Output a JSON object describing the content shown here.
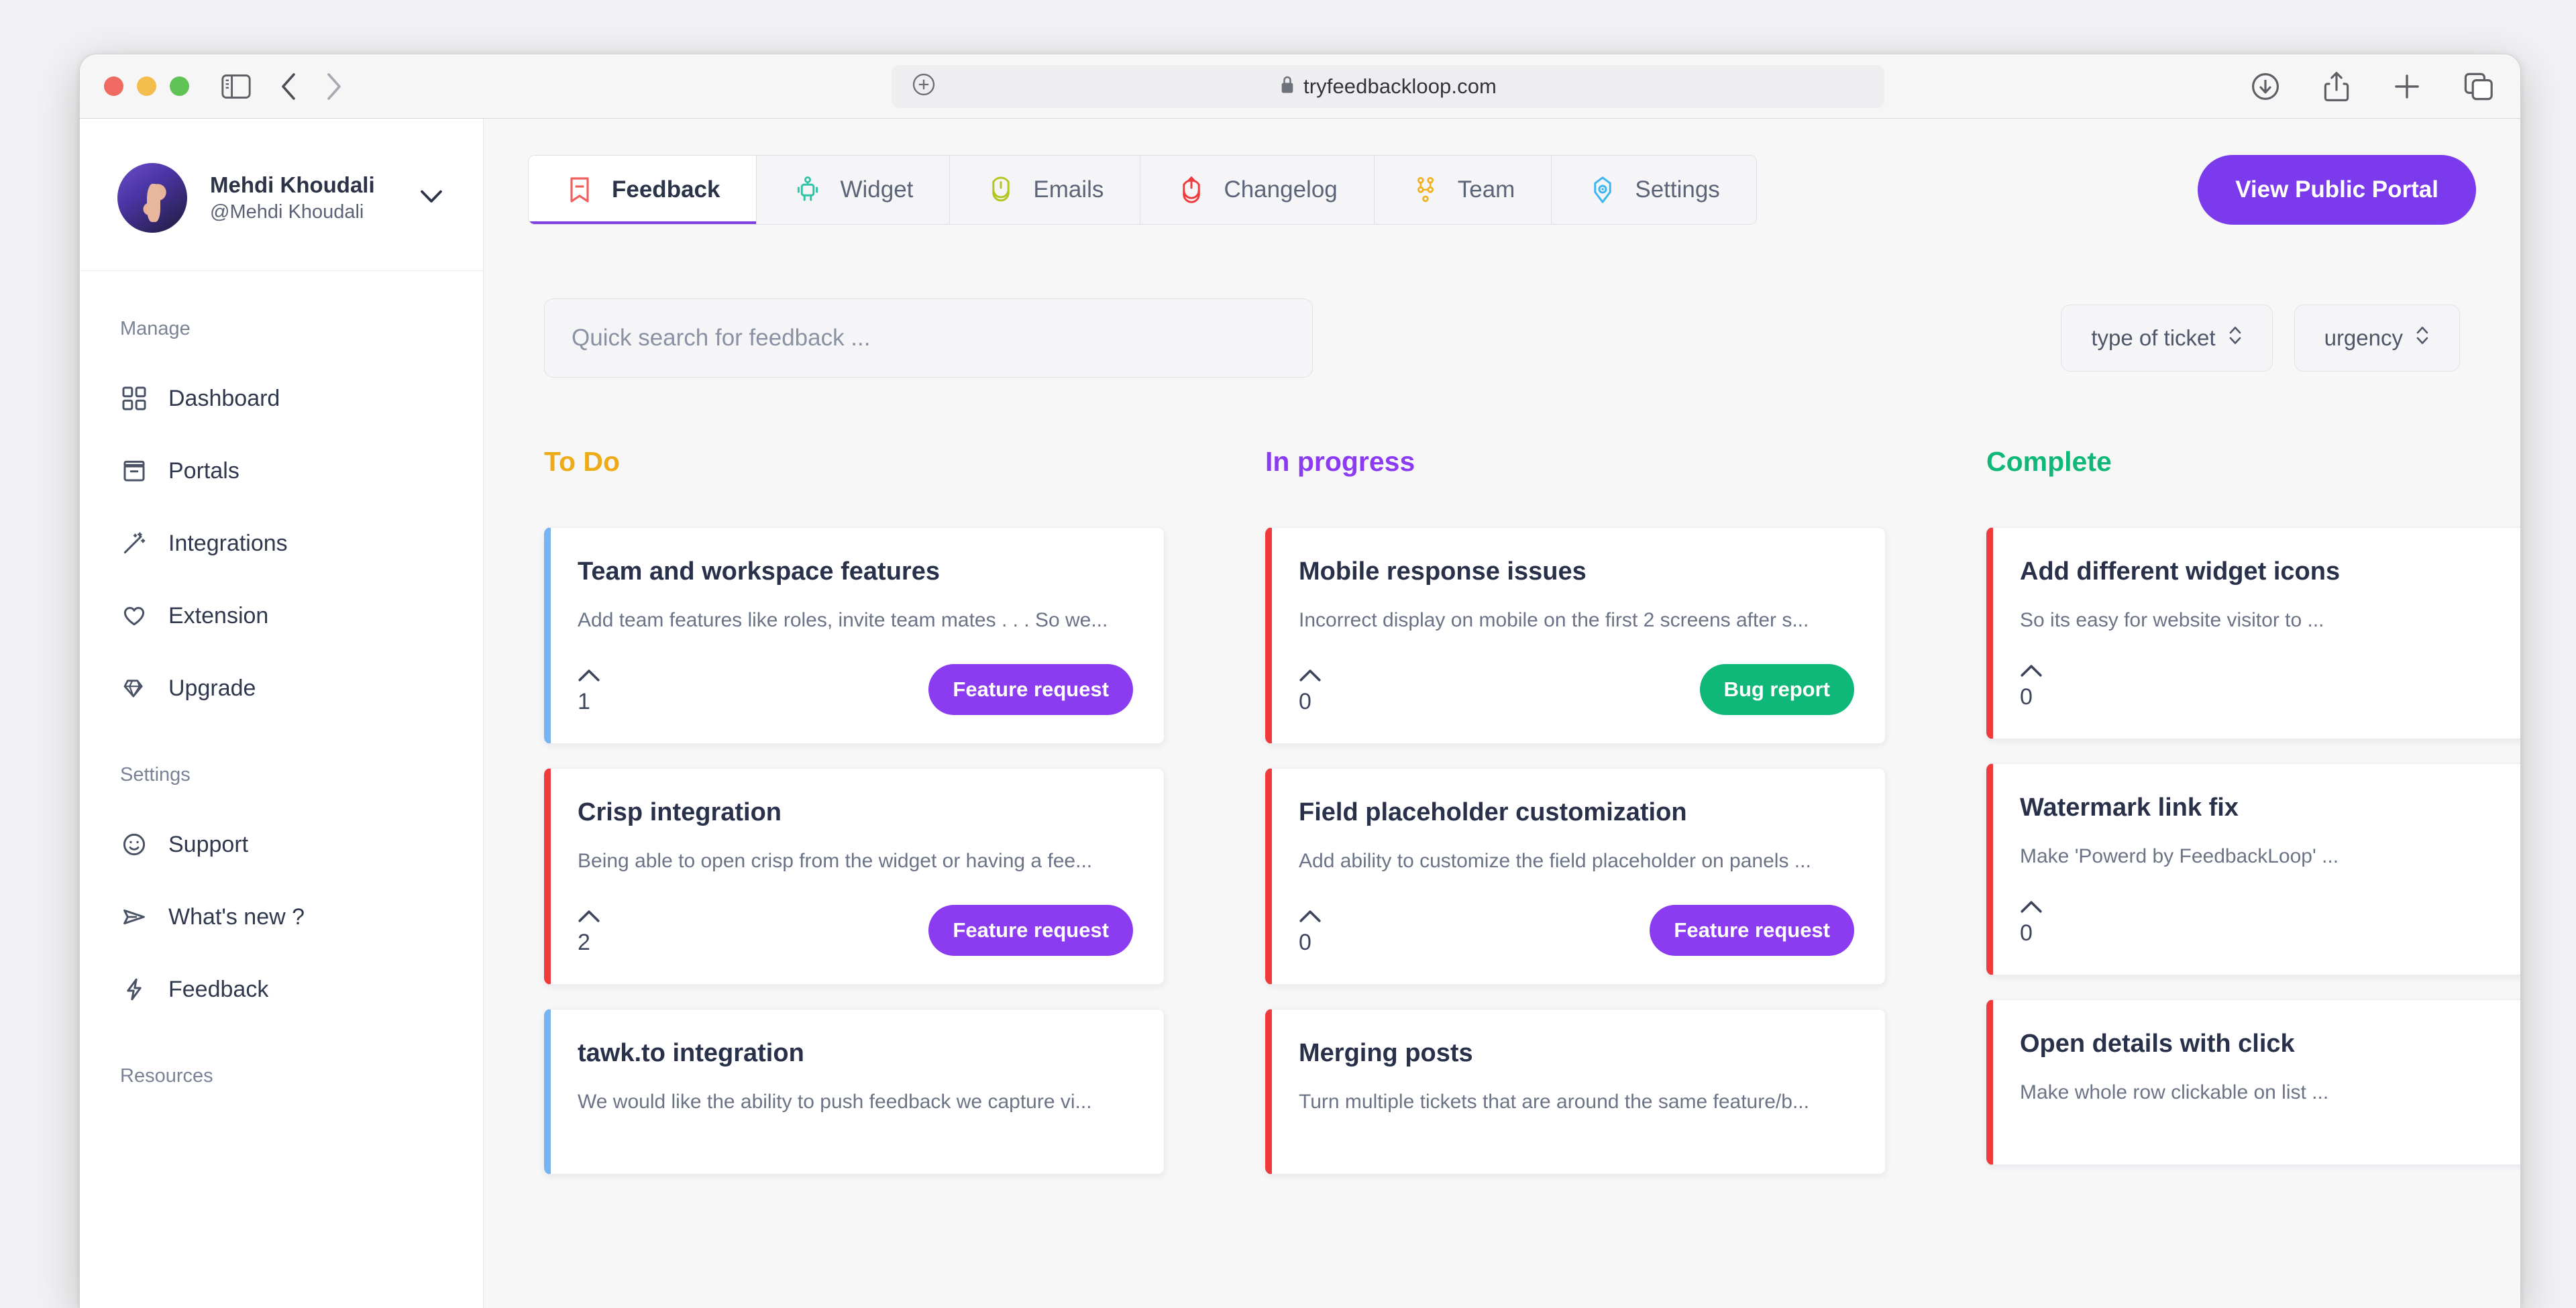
{
  "browser": {
    "url": "tryfeedbackloop.com",
    "lock_icon": "lock-icon",
    "traffic_lights": [
      "close-button",
      "minimize-button",
      "maximize-button"
    ],
    "toolbar_icons": [
      "sidebar-toggle-icon",
      "back-icon",
      "forward-icon",
      "downloads-icon",
      "share-icon",
      "new-tab-icon",
      "tab-overview-icon"
    ]
  },
  "sidebar": {
    "profile": {
      "name": "Mehdi Khoudali",
      "handle": "@Mehdi Khoudali"
    },
    "sections": [
      {
        "heading": "Manage",
        "items": [
          {
            "label": "Dashboard",
            "icon": "grid-icon"
          },
          {
            "label": "Portals",
            "icon": "box-icon"
          },
          {
            "label": "Integrations",
            "icon": "magic-wand-icon"
          },
          {
            "label": "Extension",
            "icon": "heart-icon"
          },
          {
            "label": "Upgrade",
            "icon": "gem-icon"
          }
        ]
      },
      {
        "heading": "Settings",
        "items": [
          {
            "label": "Support",
            "icon": "smiley-icon"
          },
          {
            "label": "What's new ?",
            "icon": "send-icon"
          },
          {
            "label": "Feedback",
            "icon": "bolt-icon"
          }
        ]
      },
      {
        "heading": "Resources",
        "items": []
      }
    ]
  },
  "tabs": [
    {
      "label": "Feedback",
      "icon": "feedback-icon",
      "color": "#ef6060",
      "active": true
    },
    {
      "label": "Widget",
      "icon": "robot-icon",
      "color": "#2ec4a5",
      "active": false
    },
    {
      "label": "Emails",
      "icon": "email-icon",
      "color": "#b4c521",
      "active": false
    },
    {
      "label": "Changelog",
      "icon": "changelog-icon",
      "color": "#ef3b3b",
      "active": false
    },
    {
      "label": "Team",
      "icon": "team-icon",
      "color": "#f1b11f",
      "active": false
    },
    {
      "label": "Settings",
      "icon": "settings-icon",
      "color": "#3bb6f0",
      "active": false
    }
  ],
  "header": {
    "portal_button": "View Public Portal",
    "portal_button_color": "#7c3aed"
  },
  "search": {
    "placeholder": "Quick search for feedback ...",
    "value": ""
  },
  "filters": [
    {
      "label": "type of ticket",
      "icon": "chevron-updown-icon"
    },
    {
      "label": "urgency",
      "icon": "chevron-updown-icon"
    }
  ],
  "board": {
    "columns": [
      {
        "title": "To Do",
        "title_color": "#edab17",
        "cards": [
          {
            "title": "Team and workspace features",
            "desc": "Add team features like roles, invite team mates . . . So we...",
            "votes": "1",
            "badge": "Feature request",
            "badge_color": "#8b3cf0",
            "edge_color": "#78b2f0"
          },
          {
            "title": "Crisp integration",
            "desc": "Being able to open crisp from the widget or having a fee...",
            "votes": "2",
            "badge": "Feature request",
            "badge_color": "#8b3cf0",
            "edge_color": "#ef3b3b"
          },
          {
            "title": "tawk.to integration",
            "desc": "We would like the ability to push feedback we capture vi...",
            "votes": "",
            "badge": "",
            "badge_color": "#8b3cf0",
            "edge_color": "#78b2f0"
          }
        ]
      },
      {
        "title": "In progress",
        "title_color": "#8b3cf0",
        "cards": [
          {
            "title": "Mobile response issues",
            "desc": "Incorrect display on mobile on the first 2 screens after s...",
            "votes": "0",
            "badge": "Bug report",
            "badge_color": "#0fb878",
            "edge_color": "#ef3b3b"
          },
          {
            "title": "Field placeholder customization",
            "desc": "Add ability to customize the field placeholder on panels ...",
            "votes": "0",
            "badge": "Feature request",
            "badge_color": "#8b3cf0",
            "edge_color": "#ef3b3b"
          },
          {
            "title": "Merging posts",
            "desc": "Turn multiple tickets that are around the same feature/b...",
            "votes": "",
            "badge": "",
            "badge_color": "#8b3cf0",
            "edge_color": "#ef3b3b"
          }
        ]
      },
      {
        "title": "Complete",
        "title_color": "#0fb878",
        "cards": [
          {
            "title": "Add different widget icons",
            "desc": "So its easy for website visitor to ...",
            "votes": "0",
            "badge": "",
            "badge_color": "#8b3cf0",
            "edge_color": "#ef3b3b"
          },
          {
            "title": "Watermark link fix",
            "desc": "Make 'Powerd by FeedbackLoop' ...",
            "votes": "0",
            "badge": "",
            "badge_color": "#8b3cf0",
            "edge_color": "#ef3b3b"
          },
          {
            "title": "Open details with click",
            "desc": "Make whole row clickable on list ...",
            "votes": "",
            "badge": "",
            "badge_color": "#8b3cf0",
            "edge_color": "#ef3b3b"
          }
        ]
      }
    ]
  }
}
